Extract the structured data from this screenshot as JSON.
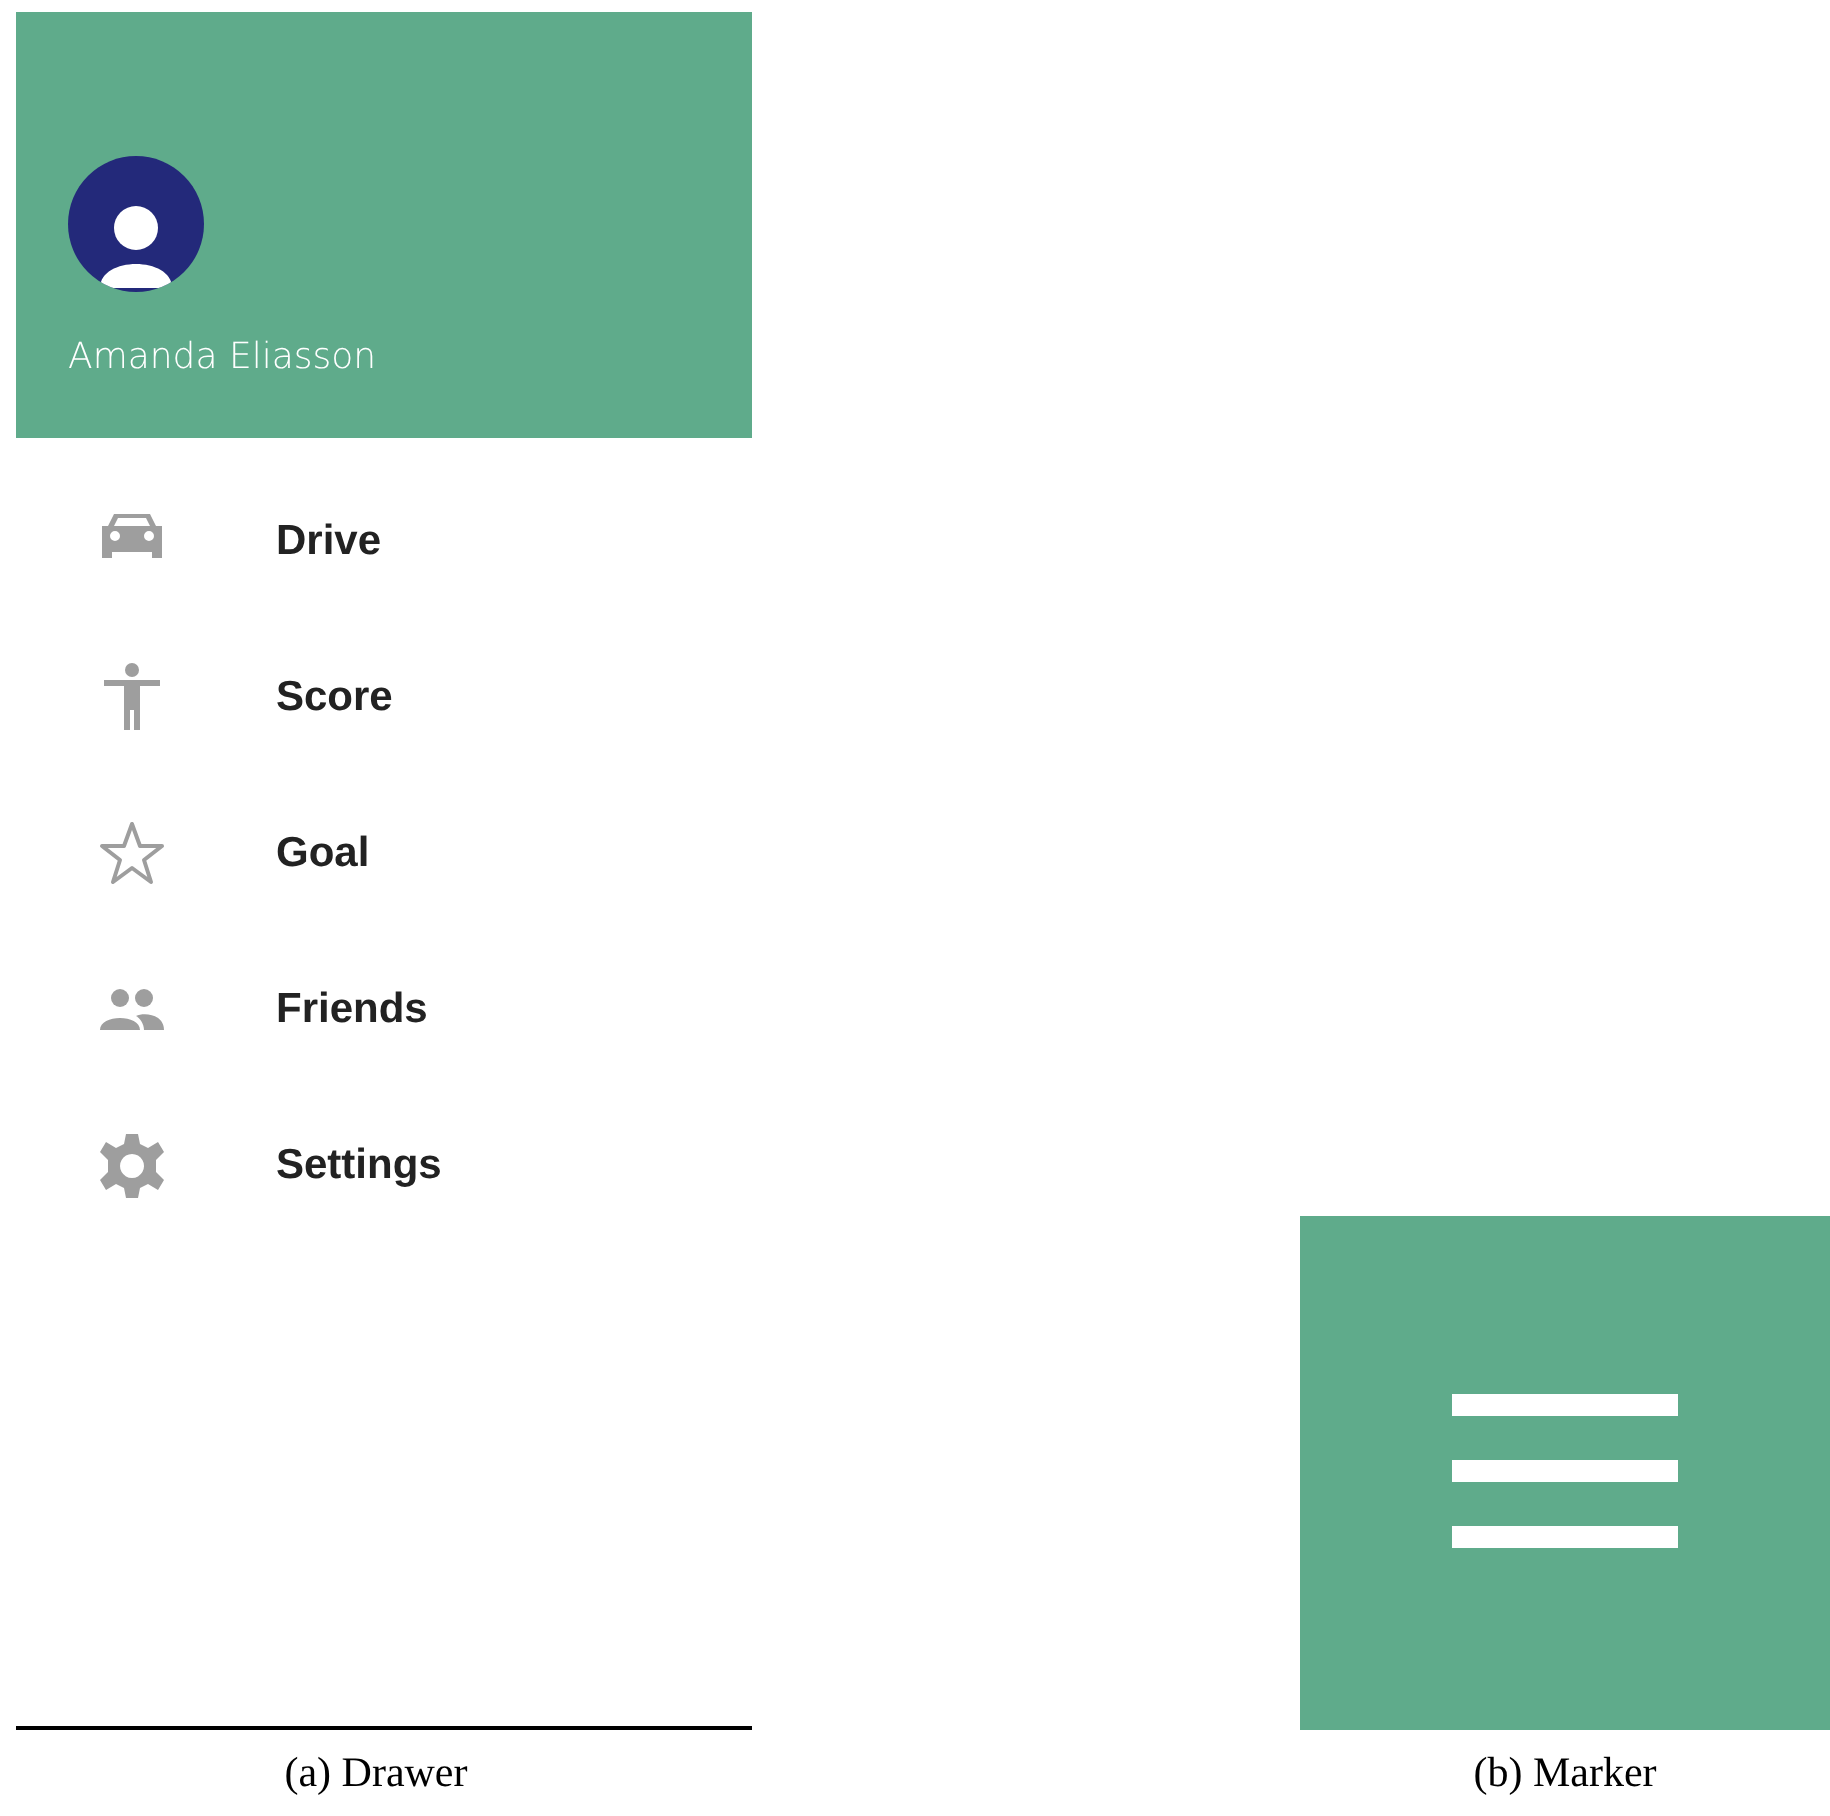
{
  "drawer": {
    "user_name": "Amanda Eliasson",
    "menu": [
      {
        "kind": "car",
        "label": "Drive"
      },
      {
        "kind": "person",
        "label": "Score"
      },
      {
        "kind": "star",
        "label": "Goal"
      },
      {
        "kind": "group",
        "label": "Friends"
      },
      {
        "kind": "gear",
        "label": "Settings"
      }
    ],
    "caption": "(a) Drawer"
  },
  "marker": {
    "caption": "(b) Marker"
  }
}
